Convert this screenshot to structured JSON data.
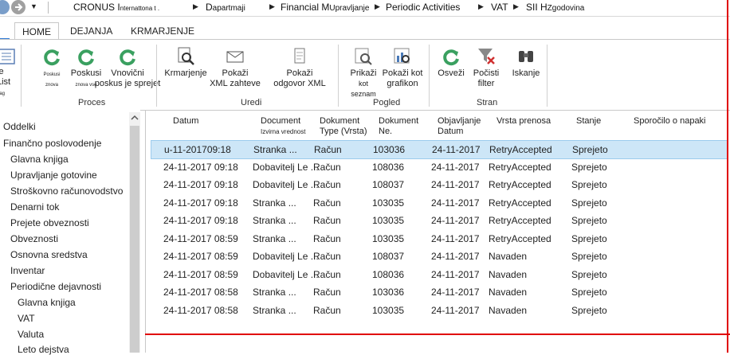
{
  "breadcrumb": {
    "company": "CRONUS I",
    "company_small": "nternattona t .",
    "dept_a": "D",
    "dept_b": "apartmaji",
    "fin_a": "Financial M",
    "fin_b": "Upravljanje",
    "periodic": "Periodic Activities",
    "vat": "VAT",
    "last_a": "SII H",
    "last_b": "Zgodovina"
  },
  "tabs": {
    "home": "HOME",
    "actions": "DEJANJA",
    "navigate": "KRMARJENJE"
  },
  "ribbon": {
    "list_a": "je",
    "list_b": "List",
    "list_c": "nag",
    "retry_small_1": "Poskusi znova",
    "retry_label": "Poskusi",
    "retry_small_2": "znova vse",
    "new_retry_a": "Vnovični",
    "new_retry_b": "poskus je sprejet",
    "proces": "Proces",
    "navigate": "Krmarjenje",
    "show_req_a": "Pokaži",
    "show_req_b": "XML zahteve",
    "show_resp_a": "Pokaži",
    "show_resp_b": "odgovor XML",
    "uredi": "Uredi",
    "list_view_a": "Prikaži",
    "list_view_b": "kot seznam",
    "chart_view_a": "Pokaži kot",
    "chart_view_b": "grafikon",
    "pogled": "Pogled",
    "refresh": "Osveži",
    "clear_a": "Počisti",
    "clear_b": "filter",
    "search": "Iskanje",
    "stran": "Stran"
  },
  "sidebar": {
    "items": [
      "Oddelki",
      "Finančno poslovodenje",
      "Glavna knjiga",
      "Upravljanje gotovine",
      "Stroškovno računovodstvo",
      "Denarni tok",
      "Prejete obveznosti",
      "Obveznosti",
      "Osnovna sredstva",
      "Inventar",
      "Periodične dejavnosti",
      "Glavna knjiga",
      "VAT",
      "Valuta",
      "Leto dejstva"
    ]
  },
  "table": {
    "headers": {
      "datum": "Datum",
      "doc_a": "Document",
      "doc_b": "Izvirna vrednost",
      "type_a": "Dokument",
      "type_b": "Type (Vrsta)",
      "no_a": "Dokument",
      "no_b": "Ne.",
      "pub_a": "Objavljanje",
      "pub_b": "Datum",
      "vrsta": "Vrsta prenosa",
      "stanje": "Stanje",
      "msg": "Sporočilo o napaki"
    },
    "rows": [
      [
        "u-11-201709:18",
        "Stranka ...",
        "Račun",
        "103036",
        "24-11-2017",
        "RetryAccepted",
        "Sprejeto"
      ],
      [
        "24-11-2017 09:18",
        "Dobavitelj Le ...",
        "Račun",
        "108036",
        "24-11-2017",
        "RetryAccepted",
        "Sprejeto"
      ],
      [
        "24-11-2017 09:18",
        "Dobavitelj Le ...",
        "Račun",
        "108037",
        "24-11-2017",
        "RetryAccepted",
        "Sprejeto"
      ],
      [
        "24-11-2017 09:18",
        "Stranka ...",
        "Račun",
        "103035",
        "24-11-2017",
        "RetryAccepted",
        "Sprejeto"
      ],
      [
        "24-11-2017 09:18",
        "Stranka ...",
        "Račun",
        "103035",
        "24-11-2017",
        "RetryAccepted",
        "Sprejeto"
      ],
      [
        "24-11-2017 08:59",
        "Stranka ...",
        "Račun",
        "103035",
        "24-11-2017",
        "RetryAccepted",
        "Sprejeto"
      ],
      [
        "24-11-2017 08:59",
        "Dobavitelj Le ...",
        "Račun",
        "108037",
        "24-11-2017",
        "Navaden",
        "Sprejeto"
      ],
      [
        "24-11-2017 08:59",
        "Dobavitelj Le ...",
        "Račun",
        "108036",
        "24-11-2017",
        "Navaden",
        "Sprejeto"
      ],
      [
        "24-11-2017 08:58",
        "Stranka ...",
        "Račun",
        "103036",
        "24-11-2017",
        "Navaden",
        "Sprejeto"
      ],
      [
        "24-11-2017 08:58",
        "Stranka ...",
        "Račun",
        "103035",
        "24-11-2017",
        "Navaden",
        "Sprejeto"
      ]
    ]
  },
  "colors": {
    "accent": "#2a78d4",
    "selected": "#cde6f7",
    "refresh_green": "#3aa060",
    "annotation_red": "#e00000"
  },
  "icons": {
    "back": "back-arrow-icon",
    "forward": "forward-arrow-icon",
    "refresh": "refresh-icon",
    "clear": "clear-filter-icon",
    "search": "binoculars-icon"
  }
}
